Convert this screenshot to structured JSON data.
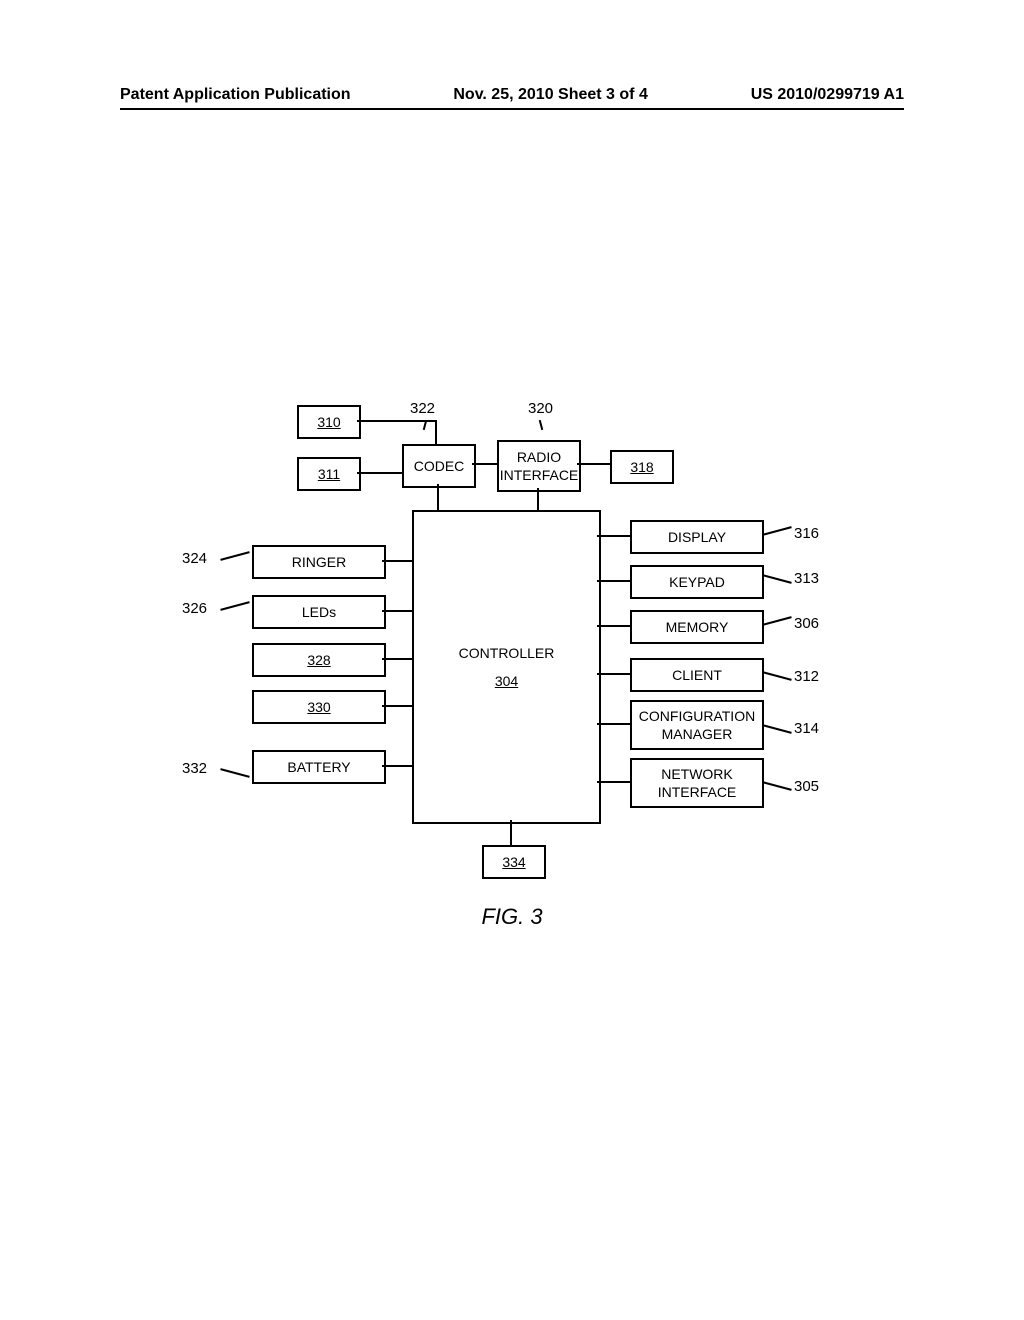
{
  "header": {
    "left": "Patent Application Publication",
    "center": "Nov. 25, 2010  Sheet 3 of 4",
    "right": "US 2010/0299719 A1"
  },
  "blocks": {
    "b310": "310",
    "b311": "311",
    "codec": "CODEC",
    "radio_interface": "RADIO\nINTERFACE",
    "b318": "318",
    "ringer": "RINGER",
    "leds": "LEDs",
    "b328": "328",
    "b330": "330",
    "battery": "BATTERY",
    "controller_label": "CONTROLLER",
    "controller_num": "304",
    "display": "DISPLAY",
    "keypad": "KEYPAD",
    "memory": "MEMORY",
    "client": "CLIENT",
    "cfg_manager": "CONFIGURATION\nMANAGER",
    "network_interface": "NETWORK\nINTERFACE",
    "b334": "334"
  },
  "labels": {
    "l322": "322",
    "l320": "320",
    "l324": "324",
    "l326": "326",
    "l332": "332",
    "l316": "316",
    "l313": "313",
    "l306": "306",
    "l312": "312",
    "l314": "314",
    "l305": "305"
  },
  "caption": "FIG. 3"
}
